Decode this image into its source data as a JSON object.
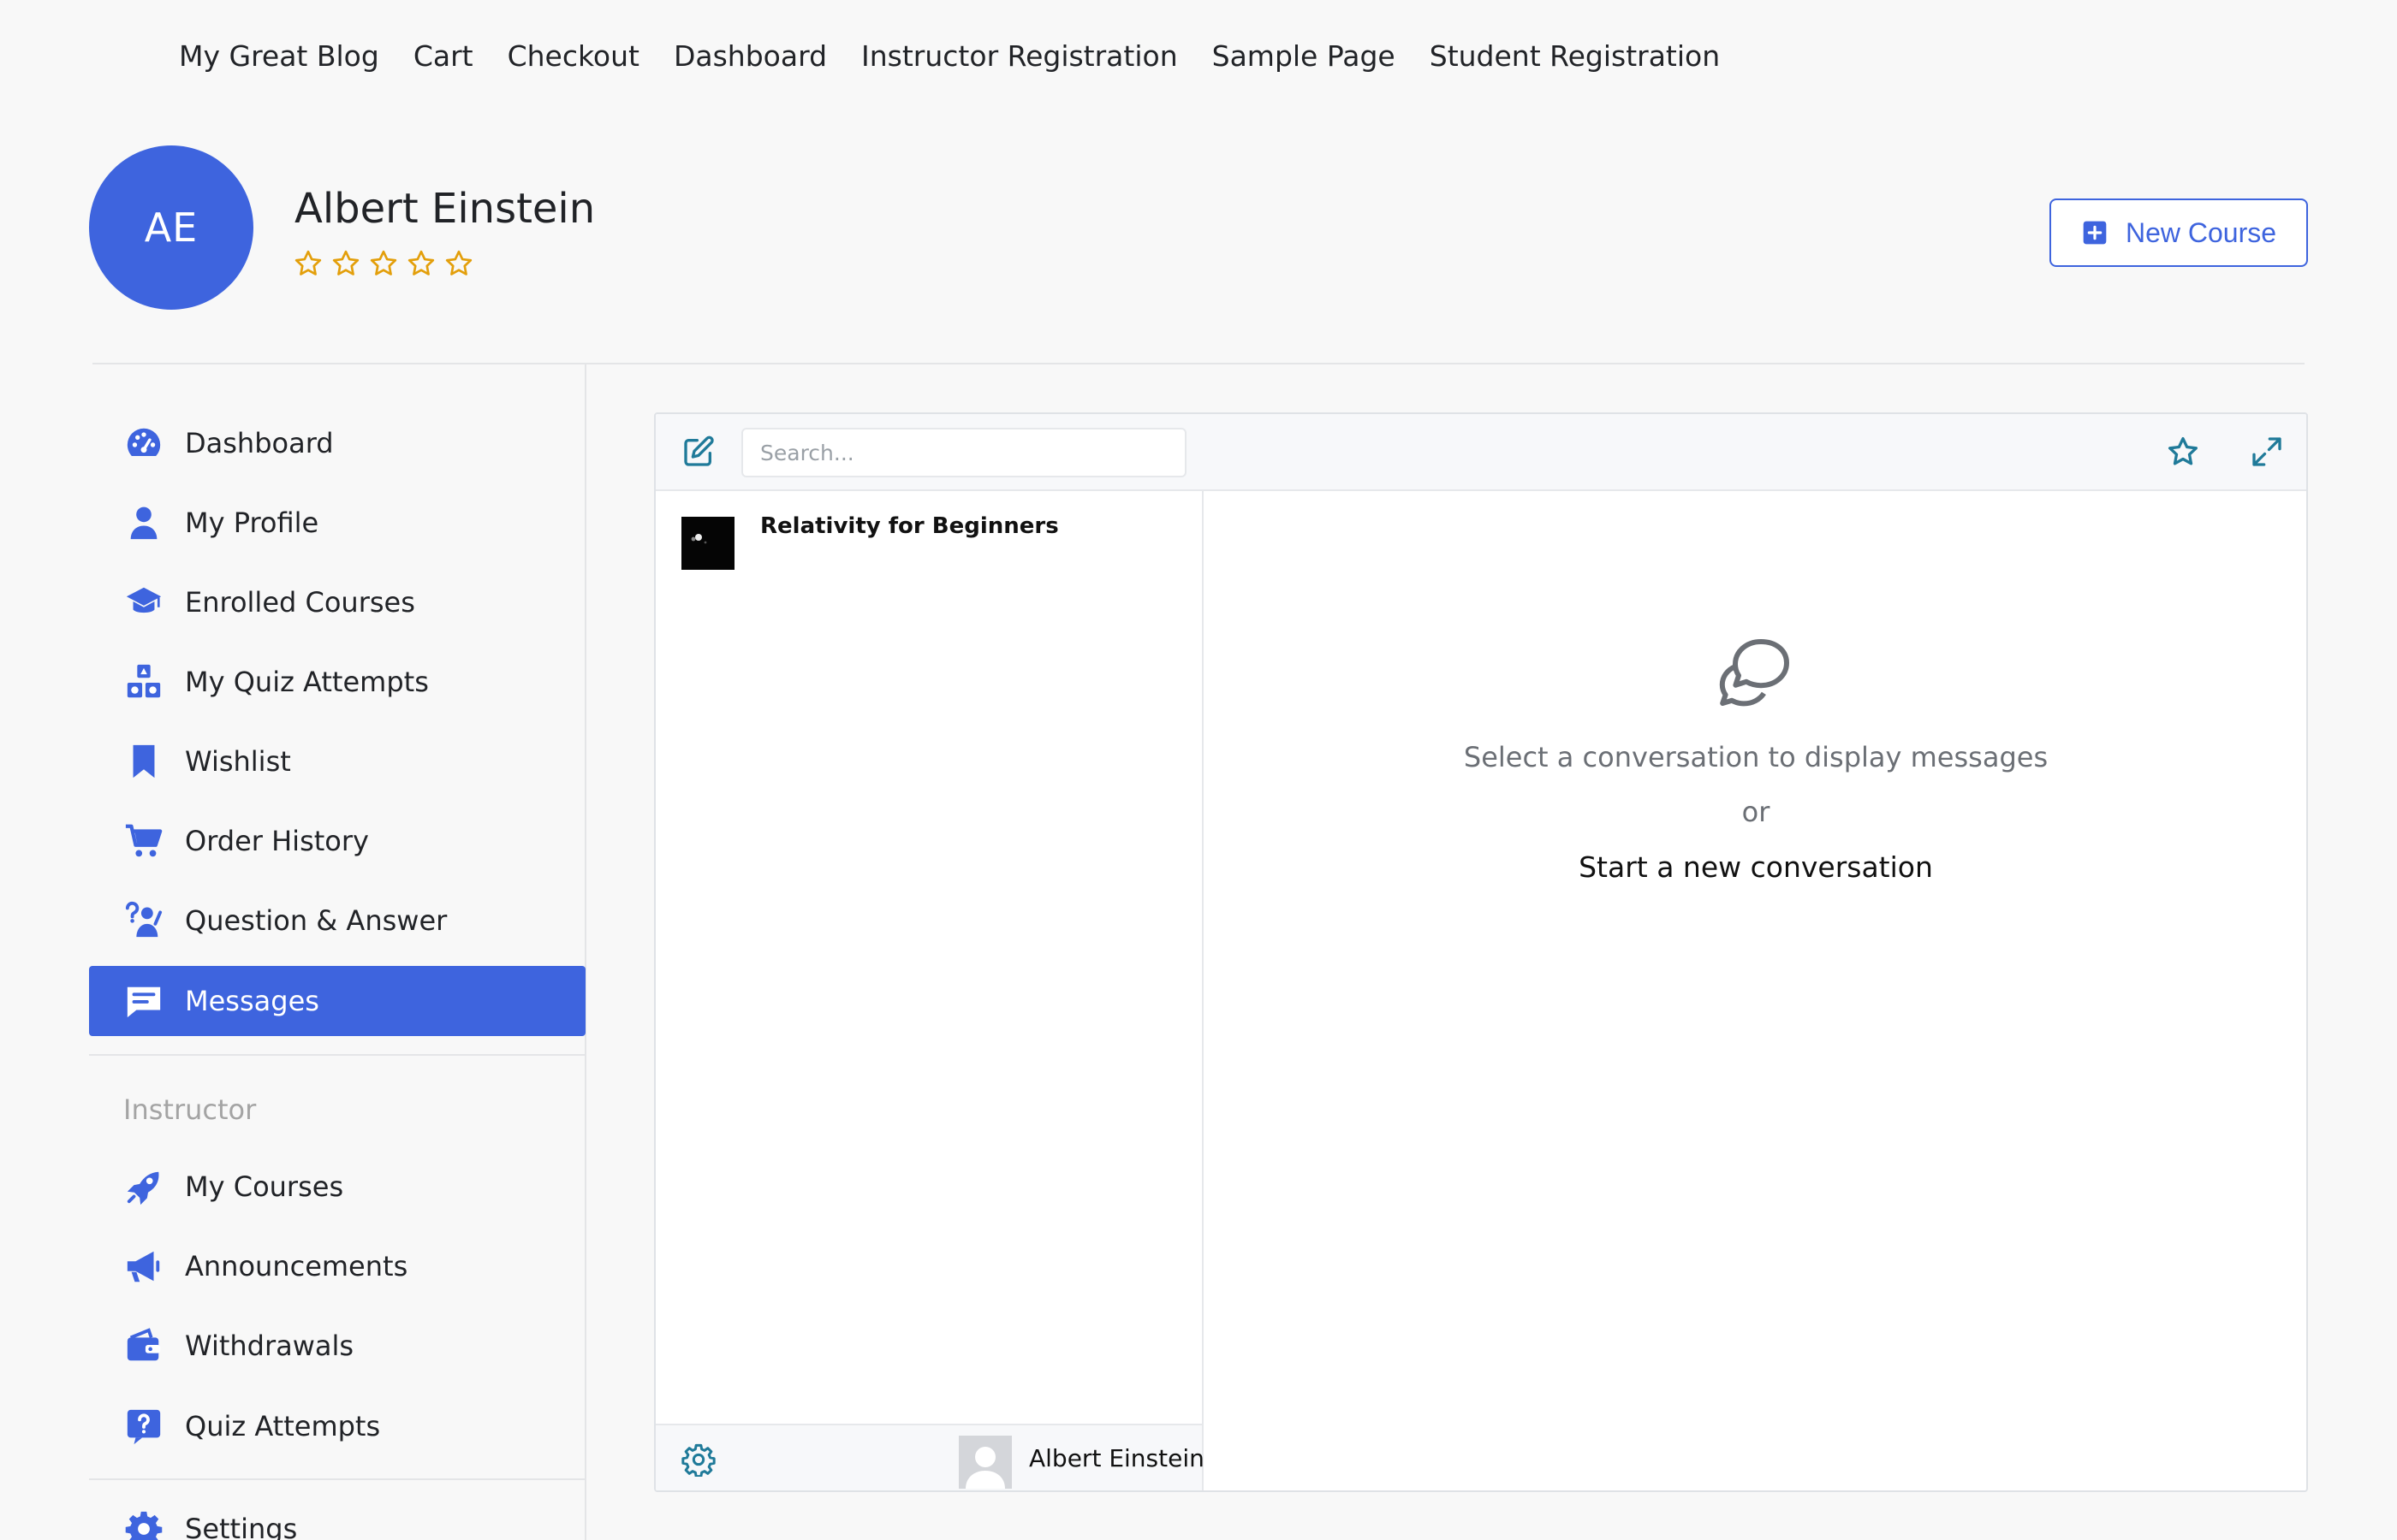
{
  "top_nav": {
    "items": [
      "My Great Blog",
      "Cart",
      "Checkout",
      "Dashboard",
      "Instructor Registration",
      "Sample Page",
      "Student Registration"
    ]
  },
  "header": {
    "avatar_initials": "AE",
    "user_name": "Albert Einstein",
    "rating_stars": 5,
    "rating_value": 0,
    "new_course_label": "New Course"
  },
  "sidebar": {
    "items": [
      {
        "label": "Dashboard",
        "icon": "dashboard-gauge-icon"
      },
      {
        "label": "My Profile",
        "icon": "user-icon"
      },
      {
        "label": "Enrolled Courses",
        "icon": "graduation-cap-icon"
      },
      {
        "label": "My Quiz Attempts",
        "icon": "quiz-shapes-icon"
      },
      {
        "label": "Wishlist",
        "icon": "bookmark-icon"
      },
      {
        "label": "Order History",
        "icon": "cart-icon"
      },
      {
        "label": "Question & Answer",
        "icon": "question-person-icon"
      },
      {
        "label": "Messages",
        "icon": "message-icon",
        "active": true
      }
    ],
    "instructor_section_label": "Instructor",
    "instructor_items": [
      {
        "label": "My Courses",
        "icon": "rocket-icon"
      },
      {
        "label": "Announcements",
        "icon": "megaphone-icon"
      },
      {
        "label": "Withdrawals",
        "icon": "wallet-icon"
      },
      {
        "label": "Quiz Attempts",
        "icon": "question-box-icon"
      }
    ],
    "settings_label": "Settings"
  },
  "messages": {
    "search_placeholder": "Search...",
    "conversations": [
      {
        "title": "Relativity for Beginners",
        "thumb": "dark-course-thumbnail"
      }
    ],
    "footer_user_name": "Albert Einstein",
    "empty_state": {
      "line1": "Select a conversation to display messages",
      "or": "or",
      "start": "Start a new conversation"
    }
  },
  "colors": {
    "brand": "#3e64de",
    "star": "#e39f0b",
    "teal_icon": "#1f7a99"
  }
}
